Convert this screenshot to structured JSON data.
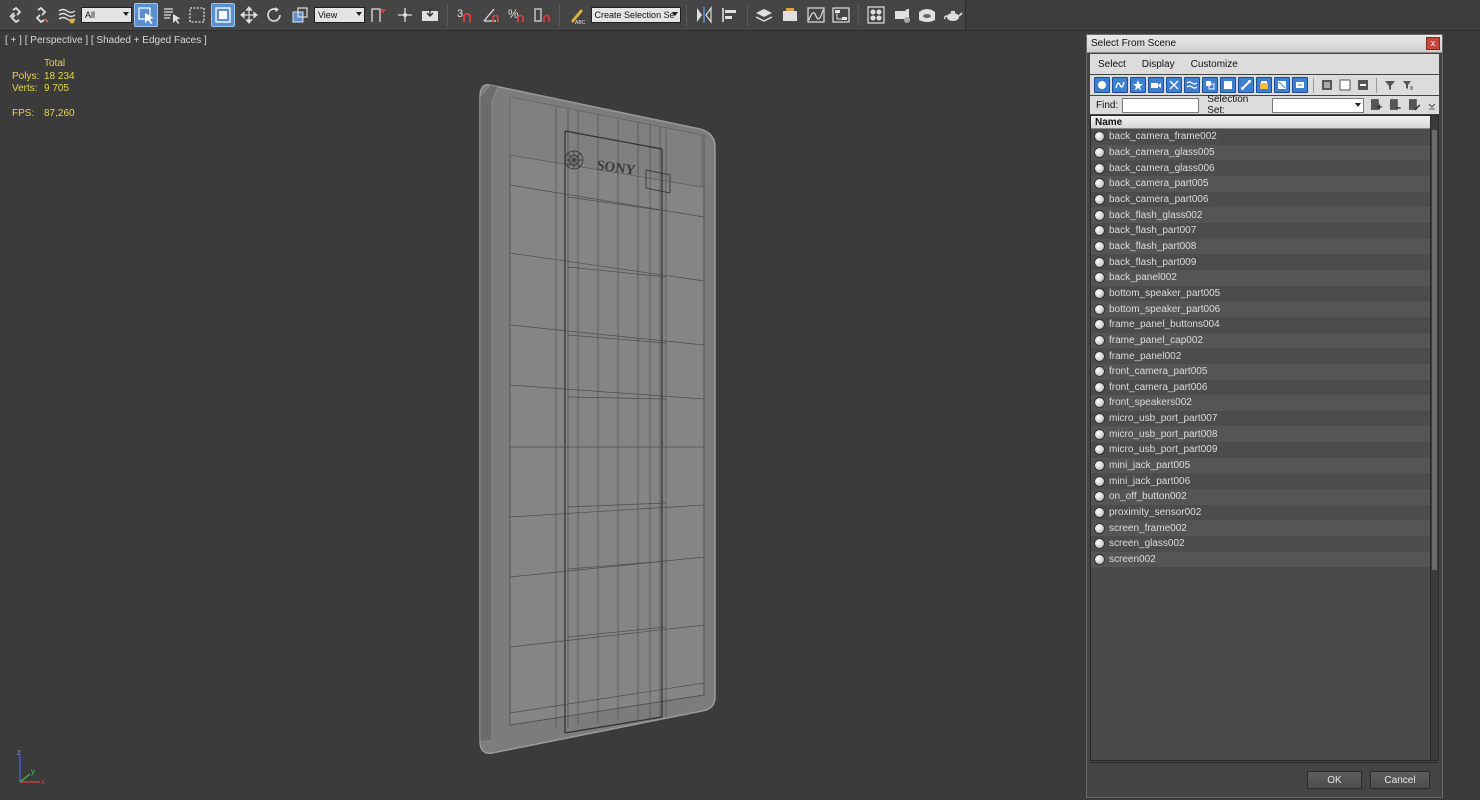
{
  "toolbar": {
    "filter_value": "All",
    "refcoord_value": "View",
    "selection_set_placeholder": "Create Selection Se",
    "icons": [
      "link-icon",
      "unlink-icon",
      "bind-spacewarp-icon",
      "select-object-icon",
      "select-by-name-icon",
      "rect-region-icon",
      "window-crossing-icon",
      "move-icon",
      "rotate-icon",
      "scale-icon",
      "pivot-icon",
      "select-manipulate-icon",
      "keyboard-shortcut-icon",
      "snap-3d-icon",
      "angle-snap-icon",
      "percent-snap-icon",
      "spinner-snap-icon",
      "edit-named-sets-icon",
      "mirror-icon",
      "align-icon",
      "layer-manager-icon",
      "scene-explorer-icon",
      "curve-editor-icon",
      "schematic-view-icon",
      "material-editor-icon",
      "render-setup-icon",
      "rendered-frame-icon",
      "render-production-icon",
      "render-teapot-icon"
    ]
  },
  "viewport": {
    "label": "[ + ] [ Perspective ] [ Shaded + Edged Faces ]",
    "stats": {
      "header": "Total",
      "polys_label": "Polys:",
      "polys_value": "18 234",
      "verts_label": "Verts:",
      "verts_value": "9 705",
      "fps_label": "FPS:",
      "fps_value": "87,260"
    },
    "logo_text": "SONY",
    "axis": {
      "x": "x",
      "y": "y",
      "z": "z"
    }
  },
  "dialog": {
    "title": "Select From Scene",
    "close_label": "x",
    "menu": [
      "Select",
      "Display",
      "Customize"
    ],
    "find_label": "Find:",
    "find_value": "",
    "selection_set_label": "Selection Set:",
    "selection_set_value": "",
    "column_header": "Name",
    "objects": [
      "back_camera_frame002",
      "back_camera_glass005",
      "back_camera_glass006",
      "back_camera_part005",
      "back_camera_part006",
      "back_flash_glass002",
      "back_flash_part007",
      "back_flash_part008",
      "back_flash_part009",
      "back_panel002",
      "bottom_speaker_part005",
      "bottom_speaker_part006",
      "frame_panel_buttons004",
      "frame_panel_cap002",
      "frame_panel002",
      "front_camera_part005",
      "front_camera_part006",
      "front_speakers002",
      "micro_usb_port_part007",
      "micro_usb_port_part008",
      "micro_usb_port_part009",
      "mini_jack_part005",
      "mini_jack_part006",
      "on_off_button002",
      "proximity_sensor002",
      "screen_frame002",
      "screen_glass002",
      "screen002"
    ],
    "ok_label": "OK",
    "cancel_label": "Cancel"
  },
  "colors": {
    "viewport_bg": "#3b3b3b",
    "stats_text": "#e6d54a",
    "active_button": "#5a8fd0",
    "dialog_icon_blue": "#3f7fd0"
  }
}
